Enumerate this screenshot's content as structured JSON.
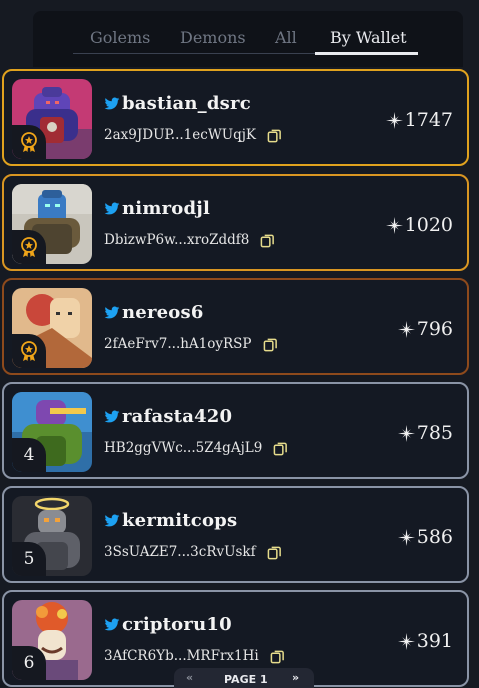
{
  "tabs": [
    {
      "label": "Golems"
    },
    {
      "label": "Demons"
    },
    {
      "label": "All"
    },
    {
      "label": "By Wallet"
    }
  ],
  "active_tab": "By Wallet",
  "colors": {
    "gold": "#e0a21e",
    "silver": "#d99622",
    "bronze": "#8e4a1c",
    "default": "#8a94a6",
    "twitter": "#1da1f2",
    "copy": "#e6dc8c"
  },
  "rows": [
    {
      "username": "bastian_dsrc",
      "wallet": "2ax9JDUP...1ecWUqjK",
      "score": "1747",
      "rank": ""
    },
    {
      "username": "nimrodjl",
      "wallet": "DbizwP6w...xroZddf8",
      "score": "1020",
      "rank": ""
    },
    {
      "username": "nereos6",
      "wallet": "2fAeFrv7...hA1oyRSP",
      "score": "796",
      "rank": ""
    },
    {
      "username": "rafasta420",
      "wallet": "HB2ggVWc...5Z4gAjL9",
      "score": "785",
      "rank": "4"
    },
    {
      "username": "kermitcops",
      "wallet": "3SsUAZE7...3cRvUskf",
      "score": "586",
      "rank": "5"
    },
    {
      "username": "criptoru10",
      "wallet": "3AfCR6Yb...MRFrx1Hi",
      "score": "391",
      "rank": "6"
    }
  ],
  "pager": {
    "prev": "«",
    "label": "PAGE 1",
    "next": "»"
  }
}
